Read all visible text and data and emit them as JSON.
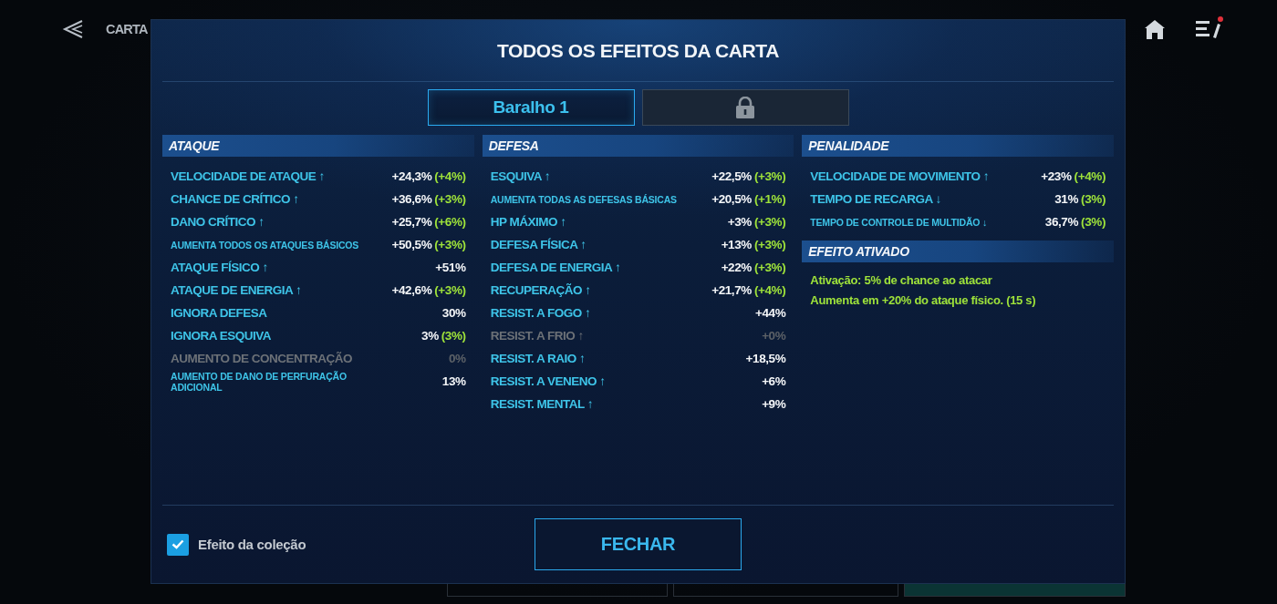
{
  "backdrop": {
    "title": "CARTA"
  },
  "dialog": {
    "title": "TODOS OS EFEITOS DA CARTA"
  },
  "tabs": [
    {
      "label": "Baralho 1",
      "selected": true,
      "locked": false
    },
    {
      "selected": false,
      "locked": true
    }
  ],
  "columns": [
    {
      "sections": [
        {
          "title": "ATAQUE",
          "kind": "stats",
          "rows": [
            {
              "label": "VELOCIDADE DE ATAQUE ↑",
              "value": "+24,3%",
              "bonus": "(+4%)",
              "kind": "standard",
              "disabled": false
            },
            {
              "label": "CHANCE DE CRÍTICO ↑",
              "value": "+36,6%",
              "bonus": "(+3%)",
              "kind": "standard",
              "disabled": false
            },
            {
              "label": "DANO CRÍTICO ↑",
              "value": "+25,7%",
              "bonus": "(+6%)",
              "kind": "standard",
              "disabled": false
            },
            {
              "label": "AUMENTA TODOS OS ATAQUES BÁSICOS",
              "value": "+50,5%",
              "bonus": "(+3%)",
              "kind": "compact",
              "disabled": false
            },
            {
              "label": "ATAQUE FÍSICO ↑",
              "value": "+51%",
              "kind": "standard",
              "disabled": false
            },
            {
              "label": "ATAQUE DE ENERGIA ↑",
              "value": "+42,6%",
              "bonus": "(+3%)",
              "kind": "standard",
              "disabled": false
            },
            {
              "label": "IGNORA DEFESA",
              "value": "30%",
              "kind": "standard",
              "disabled": false
            },
            {
              "label": "IGNORA ESQUIVA",
              "value": "3%",
              "bonus": "(3%)",
              "kind": "standard",
              "disabled": false
            },
            {
              "label": "AUMENTO DE CONCENTRAÇÃO",
              "value": "0%",
              "kind": "standard",
              "disabled": true
            },
            {
              "label": "AUMENTO DE DANO DE PERFURAÇÃO ADICIONAL",
              "value": "13%",
              "kind": "compact",
              "disabled": false
            }
          ]
        }
      ]
    },
    {
      "sections": [
        {
          "title": "DEFESA",
          "kind": "stats",
          "rows": [
            {
              "label": "ESQUIVA ↑",
              "value": "+22,5%",
              "bonus": "(+3%)",
              "kind": "standard",
              "disabled": false
            },
            {
              "label": "AUMENTA TODAS AS DEFESAS BÁSICAS",
              "value": "+20,5%",
              "bonus": "(+1%)",
              "kind": "compact",
              "disabled": false
            },
            {
              "label": "HP MÁXIMO ↑",
              "value": "+3%",
              "bonus": "(+3%)",
              "kind": "standard",
              "disabled": false
            },
            {
              "label": "DEFESA FÍSICA ↑",
              "value": "+13%",
              "bonus": "(+3%)",
              "kind": "standard",
              "disabled": false
            },
            {
              "label": "DEFESA DE ENERGIA ↑",
              "value": "+22%",
              "bonus": "(+3%)",
              "kind": "standard",
              "disabled": false
            },
            {
              "label": "RECUPERAÇÃO ↑",
              "value": "+21,7%",
              "bonus": "(+4%)",
              "kind": "standard",
              "disabled": false
            },
            {
              "label": "RESIST. A FOGO ↑",
              "value": "+44%",
              "kind": "standard",
              "disabled": false
            },
            {
              "label": "RESIST. A FRIO ↑",
              "value": "+0%",
              "kind": "standard",
              "disabled": true
            },
            {
              "label": "RESIST. A RAIO ↑",
              "value": "+18,5%",
              "kind": "standard",
              "disabled": false
            },
            {
              "label": "RESIST. A VENENO ↑",
              "value": "+6%",
              "kind": "standard",
              "disabled": false
            },
            {
              "label": "RESIST. MENTAL ↑",
              "value": "+9%",
              "kind": "standard",
              "disabled": false
            }
          ]
        }
      ]
    },
    {
      "sections": [
        {
          "title": "PENALIDADE",
          "kind": "stats",
          "rows": [
            {
              "label": "VELOCIDADE DE MOVIMENTO ↑",
              "value": "+23%",
              "bonus": "(+4%)",
              "kind": "standard",
              "disabled": false
            },
            {
              "label": "TEMPO DE RECARGA ↓",
              "value": "31%",
              "bonus": "(3%)",
              "kind": "standard",
              "disabled": false
            },
            {
              "label": "TEMPO DE CONTROLE DE MULTIDÃO ↓",
              "value": "36,7%",
              "bonus": "(3%)",
              "kind": "compact",
              "disabled": false
            }
          ]
        },
        {
          "title": "EFEITO ATIVADO",
          "kind": "text",
          "lines": [
            "Ativação: 5% de chance ao atacar",
            "Aumenta em +20% do ataque físico. (15 s)"
          ]
        }
      ]
    }
  ],
  "collection_effect": {
    "label": "Efeito da coleção",
    "checked": true
  },
  "close_button": {
    "label": "FECHAR"
  }
}
